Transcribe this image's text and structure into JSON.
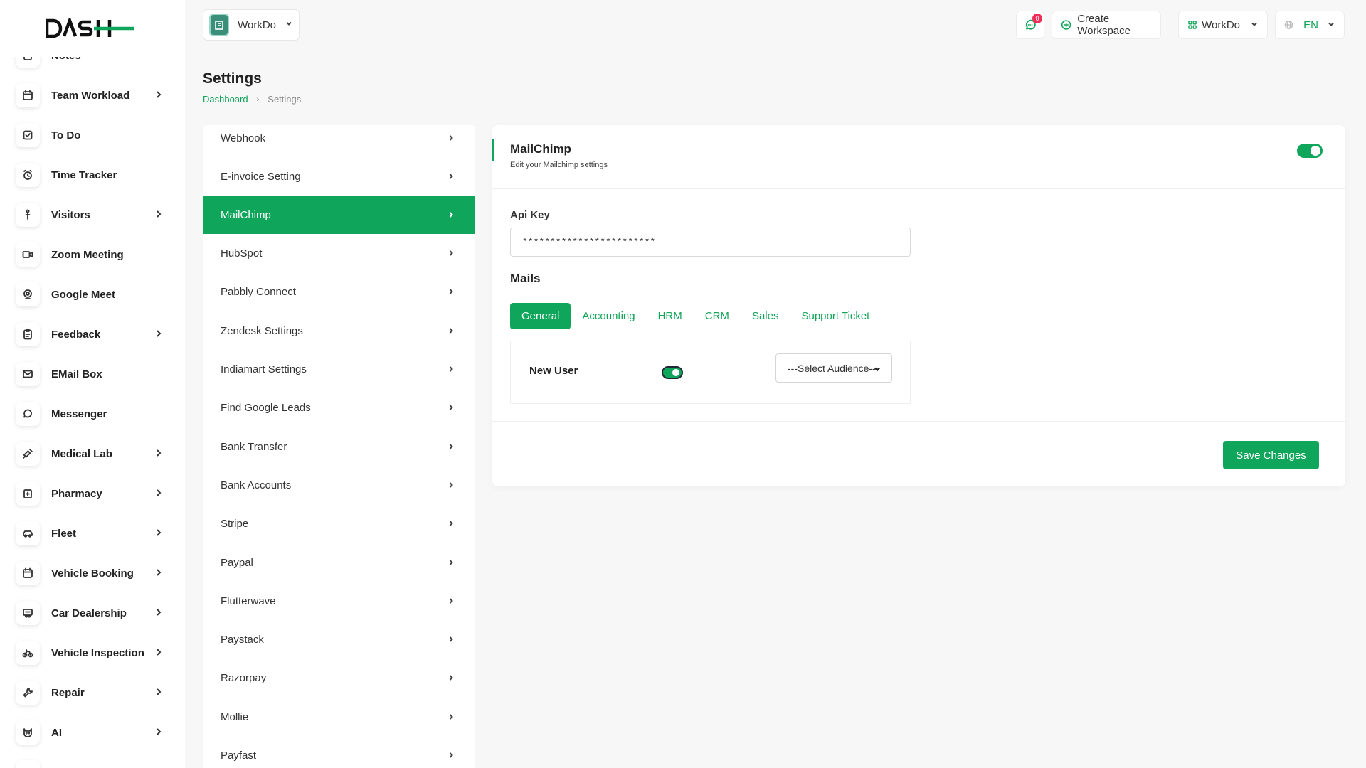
{
  "brand": {
    "logo_text": "DASH",
    "accent": "#0fa55a"
  },
  "sidebar": {
    "items": [
      {
        "label": "Notes",
        "icon": "notes-icon",
        "chevron": false
      },
      {
        "label": "Team Workload",
        "icon": "calendar-icon",
        "chevron": true
      },
      {
        "label": "To Do",
        "icon": "checkbox-icon",
        "chevron": false
      },
      {
        "label": "Time Tracker",
        "icon": "alarm-icon",
        "chevron": false
      },
      {
        "label": "Visitors",
        "icon": "person-icon",
        "chevron": true
      },
      {
        "label": "Zoom Meeting",
        "icon": "video-icon",
        "chevron": false
      },
      {
        "label": "Google Meet",
        "icon": "webcam-icon",
        "chevron": false
      },
      {
        "label": "Feedback",
        "icon": "clipboard-icon",
        "chevron": true
      },
      {
        "label": "EMail Box",
        "icon": "mail-icon",
        "chevron": false
      },
      {
        "label": "Messenger",
        "icon": "chat-icon",
        "chevron": false
      },
      {
        "label": "Medical Lab",
        "icon": "syringe-icon",
        "chevron": true
      },
      {
        "label": "Pharmacy",
        "icon": "medkit-icon",
        "chevron": true
      },
      {
        "label": "Fleet",
        "icon": "car-icon",
        "chevron": true
      },
      {
        "label": "Vehicle Booking",
        "icon": "calendar-check-icon",
        "chevron": true
      },
      {
        "label": "Car Dealership",
        "icon": "dealership-icon",
        "chevron": true
      },
      {
        "label": "Vehicle Inspection",
        "icon": "bike-icon",
        "chevron": true
      },
      {
        "label": "Repair",
        "icon": "tools-icon",
        "chevron": true
      },
      {
        "label": "AI",
        "icon": "ai-icon",
        "chevron": true
      },
      {
        "label": "",
        "icon": "more-icon",
        "chevron": false
      }
    ]
  },
  "header": {
    "workspace": {
      "label": "WorkDo"
    },
    "messages": {
      "badge": "0"
    },
    "create_workspace": "Create Workspace",
    "workdo_menu": "WorkDo",
    "language": "EN"
  },
  "page": {
    "title": "Settings",
    "breadcrumb": {
      "home": "Dashboard",
      "current": "Settings"
    }
  },
  "settings_menu": {
    "items": [
      {
        "label": "Webhook",
        "active": false
      },
      {
        "label": "E-invoice Setting",
        "active": false
      },
      {
        "label": "MailChimp",
        "active": true
      },
      {
        "label": "HubSpot",
        "active": false
      },
      {
        "label": "Pabbly Connect",
        "active": false
      },
      {
        "label": "Zendesk Settings",
        "active": false
      },
      {
        "label": "Indiamart Settings",
        "active": false
      },
      {
        "label": "Find Google Leads",
        "active": false
      },
      {
        "label": "Bank Transfer",
        "active": false
      },
      {
        "label": "Bank Accounts",
        "active": false
      },
      {
        "label": "Stripe",
        "active": false
      },
      {
        "label": "Paypal",
        "active": false
      },
      {
        "label": "Flutterwave",
        "active": false
      },
      {
        "label": "Paystack",
        "active": false
      },
      {
        "label": "Razorpay",
        "active": false
      },
      {
        "label": "Mollie",
        "active": false
      },
      {
        "label": "Payfast",
        "active": false
      }
    ]
  },
  "mailchimp": {
    "title": "MailChimp",
    "subtitle": "Edit your Mailchimp settings",
    "enabled": true,
    "api_key_label": "Api Key",
    "api_key_value": "************************",
    "mails_title": "Mails",
    "tabs": [
      {
        "label": "General",
        "active": true
      },
      {
        "label": "Accounting",
        "active": false
      },
      {
        "label": "HRM",
        "active": false
      },
      {
        "label": "CRM",
        "active": false
      },
      {
        "label": "Sales",
        "active": false
      },
      {
        "label": "Support Ticket",
        "active": false
      }
    ],
    "mail_row": {
      "label": "New User",
      "enabled": true,
      "audience": "---Select Audience---"
    },
    "save_label": "Save Changes"
  }
}
